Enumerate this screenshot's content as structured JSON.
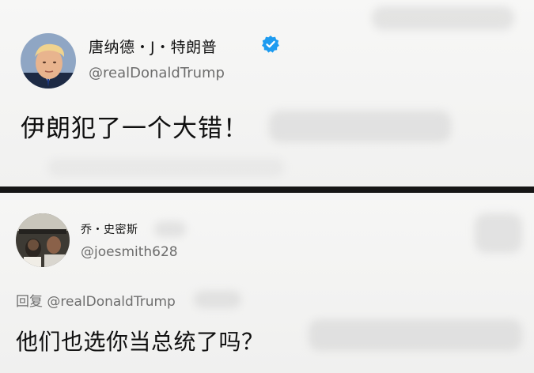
{
  "tweet1": {
    "display_name": "唐纳德・J・特朗普",
    "handle": "@realDonaldTrump",
    "text": "伊朗犯了一个大错！",
    "verified_color": "#1da1f2"
  },
  "tweet2": {
    "display_name": "乔・史密斯",
    "handle": "@joesmith628",
    "reply_prefix": "回复 @realDonaldTrump",
    "text": "他们也选你当总统了吗？"
  },
  "colors": {
    "background": "#f4f4f3",
    "divider": "#161616",
    "handle_gray": "#6d6d6d",
    "text": "#101010"
  }
}
